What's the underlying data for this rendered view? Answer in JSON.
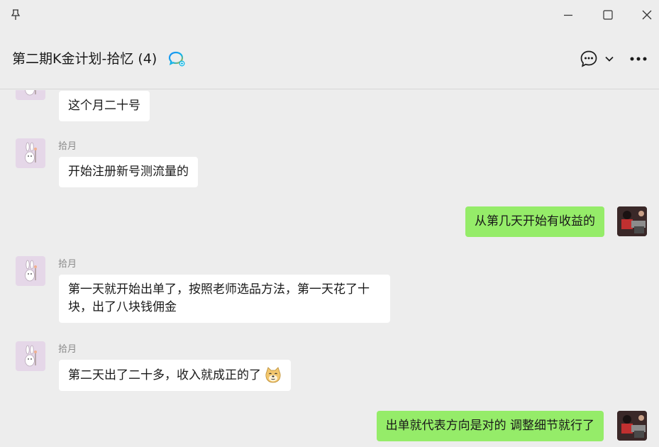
{
  "window": {
    "chat_title": "第二期K金计划-拾忆 (4)"
  },
  "messages": [
    {
      "id": 1,
      "direction": "in",
      "sender": "",
      "text": "这个月二十号"
    },
    {
      "id": 2,
      "direction": "in",
      "sender": "拾月",
      "text": "开始注册新号测流量的"
    },
    {
      "id": 3,
      "direction": "out",
      "sender": "",
      "text": "从第几天开始有收益的"
    },
    {
      "id": 4,
      "direction": "in",
      "sender": "拾月",
      "text_lines": [
        "第一天就开始出单了，按照老师选品方法，第一天花了十",
        "块，出了八块钱佣金"
      ]
    },
    {
      "id": 5,
      "direction": "in",
      "sender": "拾月",
      "text": "第二天出了二十多，收入就成正的了",
      "emoji": "doge-face-emoji"
    },
    {
      "id": 6,
      "direction": "out",
      "sender": "",
      "text": "出单就代表方向是对的 调整细节就行了"
    }
  ],
  "colors": {
    "background": "#ededed",
    "outgoing_bubble": "#95ec69",
    "incoming_bubble": "#ffffff",
    "sender_text": "#8a8a8a"
  },
  "icons": {
    "pin": "pin-icon",
    "minimize": "minimize-icon",
    "maximize": "maximize-icon",
    "close": "close-icon",
    "group_chat": "group-chat-icon",
    "chat_bubble": "chat-bubble-icon",
    "chevron": "chevron-down-icon",
    "more": "more-icon"
  }
}
